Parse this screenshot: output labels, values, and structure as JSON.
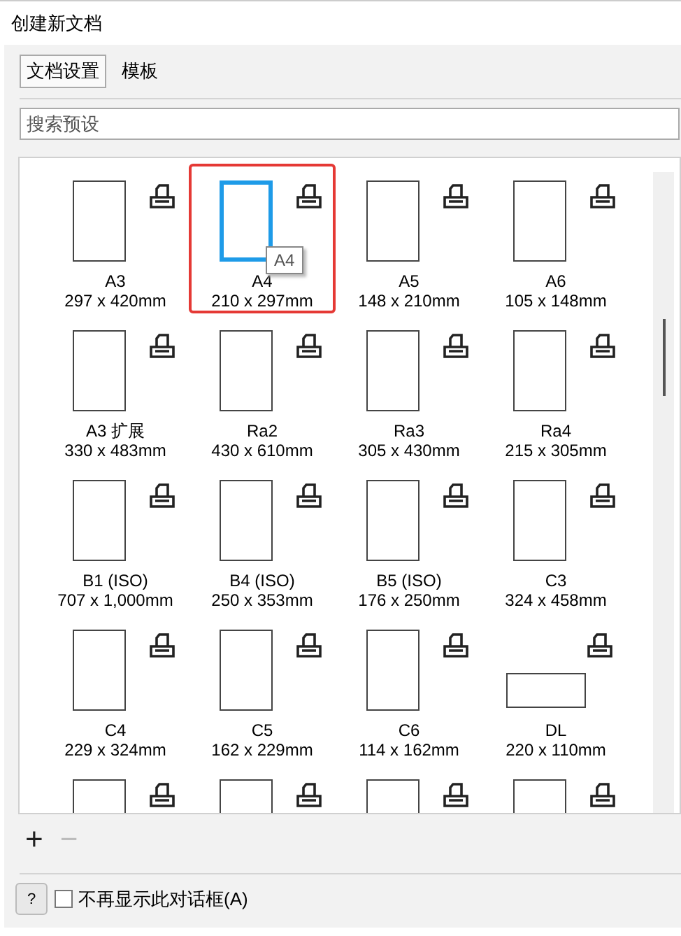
{
  "window": {
    "title": "创建新文档"
  },
  "tabs": [
    {
      "label": "文档设置",
      "selected": true
    },
    {
      "label": "模板",
      "selected": false
    }
  ],
  "search": {
    "placeholder": "搜索预设"
  },
  "presets": [
    {
      "name": "A3",
      "size": "297 x 420mm",
      "kind": "portrait",
      "selected": false
    },
    {
      "name": "A4",
      "size": "210 x 297mm",
      "kind": "portrait",
      "selected": true
    },
    {
      "name": "A5",
      "size": "148 x 210mm",
      "kind": "portrait",
      "selected": false
    },
    {
      "name": "A6",
      "size": "105 x 148mm",
      "kind": "portrait",
      "selected": false
    },
    {
      "name": "A3 扩展",
      "size": "330 x 483mm",
      "kind": "portrait",
      "selected": false
    },
    {
      "name": "Ra2",
      "size": "430 x 610mm",
      "kind": "portrait",
      "selected": false
    },
    {
      "name": "Ra3",
      "size": "305 x 430mm",
      "kind": "portrait",
      "selected": false
    },
    {
      "name": "Ra4",
      "size": "215 x 305mm",
      "kind": "portrait",
      "selected": false
    },
    {
      "name": "B1 (ISO)",
      "size": "707 x 1,000mm",
      "kind": "portrait",
      "selected": false
    },
    {
      "name": "B4 (ISO)",
      "size": "250 x 353mm",
      "kind": "portrait",
      "selected": false
    },
    {
      "name": "B5 (ISO)",
      "size": "176 x 250mm",
      "kind": "portrait",
      "selected": false
    },
    {
      "name": "C3",
      "size": "324 x 458mm",
      "kind": "portrait",
      "selected": false
    },
    {
      "name": "C4",
      "size": "229 x 324mm",
      "kind": "portrait",
      "selected": false
    },
    {
      "name": "C5",
      "size": "162 x 229mm",
      "kind": "portrait",
      "selected": false
    },
    {
      "name": "C6",
      "size": "114 x 162mm",
      "kind": "portrait",
      "selected": false
    },
    {
      "name": "DL",
      "size": "220 x 110mm",
      "kind": "landscape",
      "selected": false
    },
    {
      "kind": "portrait",
      "selected": false
    },
    {
      "kind": "portrait",
      "selected": false
    },
    {
      "kind": "portrait",
      "selected": false
    },
    {
      "kind": "portrait",
      "selected": false
    }
  ],
  "tooltip": "A4",
  "add_button": {
    "label": "+",
    "disabled": false
  },
  "remove_button": {
    "label": "−",
    "disabled": true
  },
  "help_button": {
    "label": "?"
  },
  "dont_show_again": {
    "label": "不再显示此对话框(A)",
    "checked": false
  }
}
